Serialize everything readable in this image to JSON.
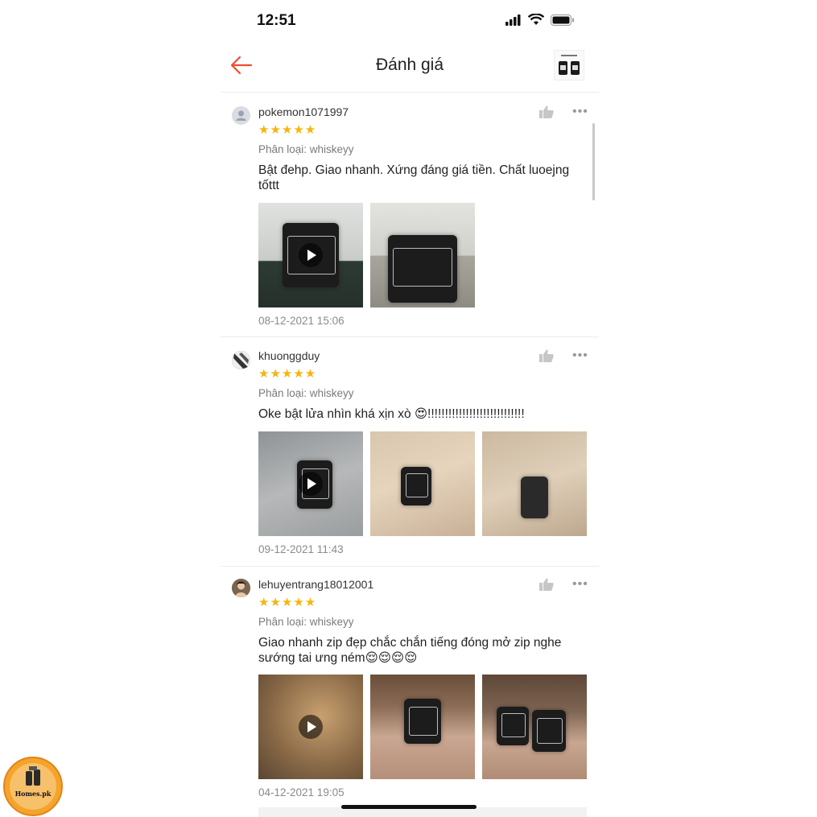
{
  "status_bar": {
    "time": "12:51"
  },
  "header": {
    "title": "Đánh giá"
  },
  "reviews": [
    {
      "username": "pokemon1071997",
      "stars": "★★★★★",
      "variant": "Phân loại: whiskeyy",
      "comment": "Bật đehp. Giao nhanh. Xứng đáng giá tiền. Chất luoejng tốttt",
      "date": "08-12-2021 15:06"
    },
    {
      "username": "khuonggduy",
      "stars": "★★★★★",
      "variant": "Phân loại: whiskeyy",
      "comment": "Oke bật lửa nhìn khá xịn xò 😍!!!!!!!!!!!!!!!!!!!!!!!!!!!!",
      "date": "09-12-2021 11:43"
    },
    {
      "username": "lehuyentrang18012001",
      "stars": "★★★★★",
      "variant": "Phân loại: whiskeyy",
      "comment": "Giao nhanh zip đẹp chắc chắn tiếng đóng mở zip nghe sướng tai ưng ném😌😌😌😌",
      "date": "04-12-2021 19:05"
    }
  ],
  "more_label": "•••",
  "badge": {
    "text": "Homes.pk"
  },
  "colors": {
    "accent": "#ee4d2d",
    "star": "#f6b40e"
  }
}
